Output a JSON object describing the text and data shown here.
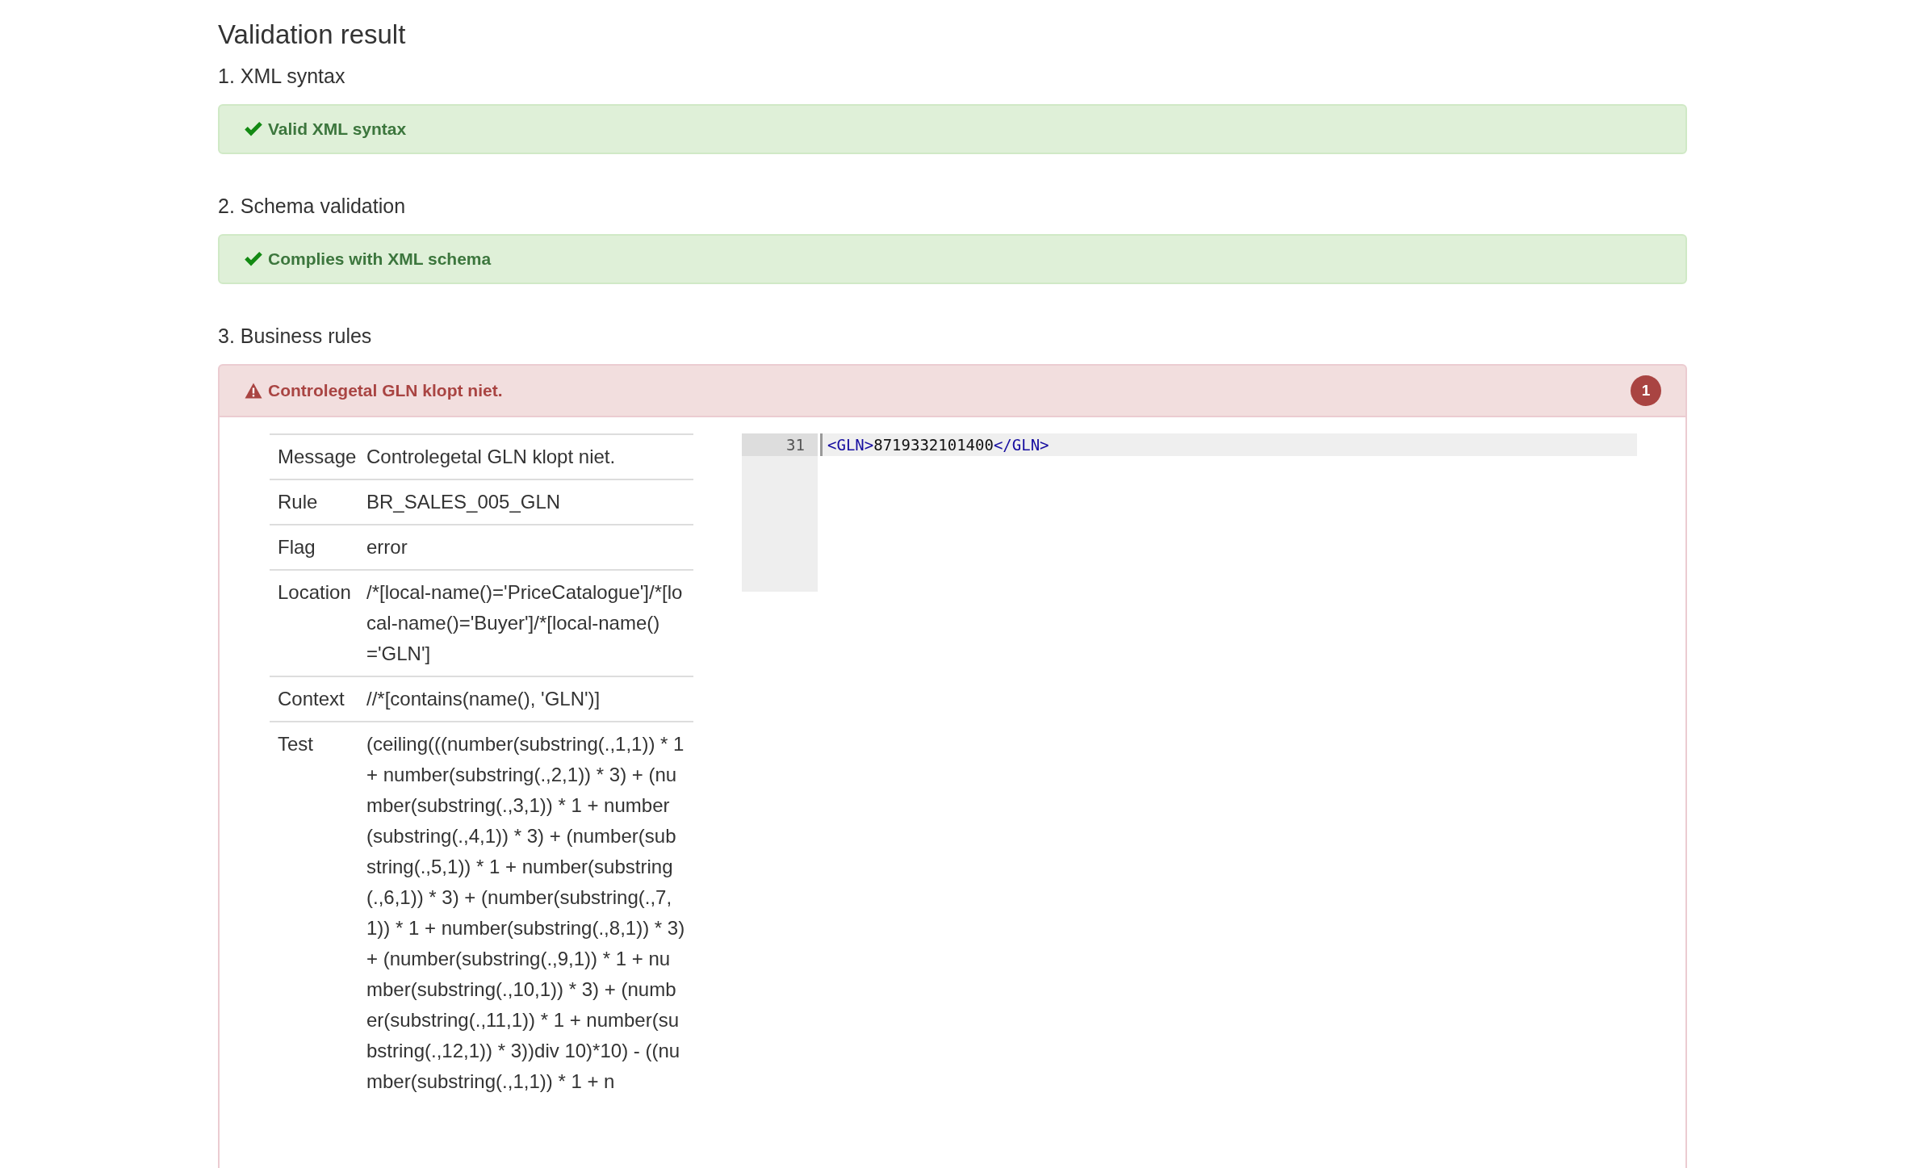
{
  "title": "Validation result",
  "sections": [
    {
      "heading": "1. XML syntax",
      "kind": "success",
      "message": "Valid XML syntax"
    },
    {
      "heading": "2. Schema validation",
      "kind": "success",
      "message": "Complies with XML schema"
    },
    {
      "heading": "3. Business rules",
      "kind": "error",
      "message": "Controlegetal GLN klopt niet.",
      "count": "1",
      "expanded": true,
      "details": [
        {
          "label": "Message",
          "value": "Controlegetal GLN klopt niet."
        },
        {
          "label": "Rule",
          "value": "BR_SALES_005_GLN"
        },
        {
          "label": "Flag",
          "value": "error"
        },
        {
          "label": "Location",
          "value": "/*[local-name()='PriceCatalogue']/*[local-name()='Buyer']/*[local-name()='GLN']"
        },
        {
          "label": "Context",
          "value": "//*[contains(name(), 'GLN')]"
        },
        {
          "label": "Test",
          "value": "(ceiling(((number(substring(.,1,1)) * 1 + number(substring(.,2,1)) * 3) + (number(substring(.,3,1)) * 1 + number(substring(.,4,1)) * 3) + (number(substring(.,5,1)) * 1 + number(substring(.,6,1)) * 3) + (number(substring(.,7,1)) * 1 + number(substring(.,8,1)) * 3) + (number(substring(.,9,1)) * 1 + number(substring(.,10,1)) * 3) + (number(substring(.,11,1)) * 1 + number(substring(.,12,1)) * 3))div 10)*10) - ((number(substring(.,1,1)) * 1 + n"
        }
      ],
      "code": [
        {
          "number": "31",
          "tokens": [
            {
              "kind": "tag",
              "text": "<GLN>"
            },
            {
              "kind": "text",
              "text": "8719332101400"
            },
            {
              "kind": "tag",
              "text": "</GLN>"
            }
          ]
        }
      ]
    }
  ]
}
